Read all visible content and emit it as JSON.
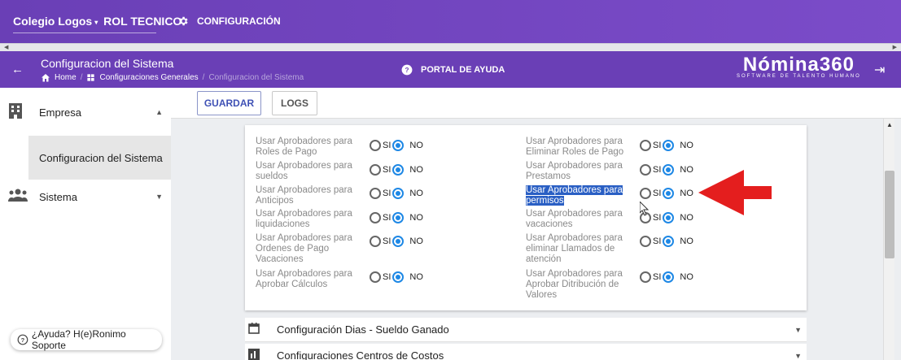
{
  "topbar": {
    "school": "Colegio Logos",
    "role": "ROL TECNICO",
    "config_label": "CONFIGURACIÓN"
  },
  "header": {
    "title": "Configuracion del Sistema",
    "breadcrumbs": [
      "Home",
      "Configuraciones Generales",
      "Configuracion del Sistema"
    ],
    "help_label": "PORTAL DE AYUDA",
    "logo": "Nómina360",
    "logo_sub": "SOFTWARE DE TALENTO HUMANO"
  },
  "sidebar": {
    "items": [
      {
        "label": "Empresa",
        "icon": "building-icon"
      },
      {
        "label": "Configuracion del Sistema"
      },
      {
        "label": "Sistema",
        "icon": "group-icon"
      }
    ]
  },
  "toolbar": {
    "save_label": "GUARDAR",
    "logs_label": "LOGS"
  },
  "options": {
    "yes": "SI",
    "no": "NO"
  },
  "left_rows": [
    "Usar Aprobadores para Roles de Pago",
    "Usar Aprobadores para sueldos",
    "Usar Aprobadores para Anticipos",
    "Usar Aprobadores para liquidaciones",
    "Usar Aprobadores para Ordenes de Pago Vacaciones",
    "Usar Aprobadores para Aprobar Cálculos"
  ],
  "right_rows": [
    "Usar Aprobadores para Eliminar Roles de Pago",
    "Usar Aprobadores para Prestamos",
    "Usar Aprobadores para permisos",
    "Usar Aprobadores para vacaciones",
    "Usar Aprobadores para eliminar Llamados de atención",
    "Usar Aprobadores para Aprobar Ditribución de Valores"
  ],
  "sections": [
    {
      "label": "Configuración Dias - Sueldo Ganado",
      "icon": "calendar-icon"
    },
    {
      "label": "Configuraciones Centros de Costos",
      "icon": "chart-icon"
    }
  ],
  "help_fab": "¿Ayuda? H(e)Ronimo Soporte"
}
